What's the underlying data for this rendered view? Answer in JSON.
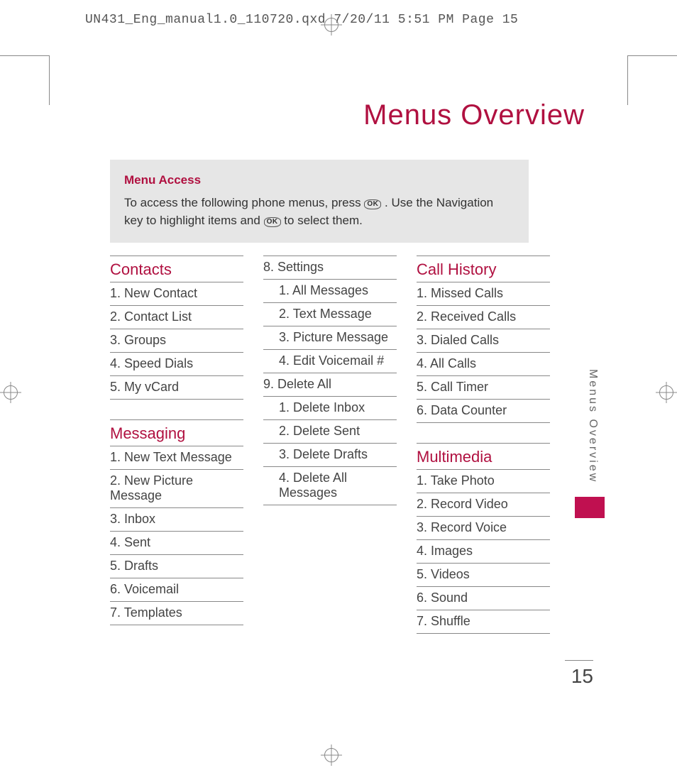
{
  "header_line": "UN431_Eng_manual1.0_110720.qxd  7/20/11  5:51 PM  Page 15",
  "page_title": "Menus Overview",
  "info_box": {
    "label": "Menu Access",
    "text_part1": "To access the following phone menus, press ",
    "text_part2": ". Use the Navigation key to highlight items and ",
    "text_part3": " to select them.",
    "ok_label": "OK"
  },
  "side_tab": "Menus Overview",
  "page_number": "15",
  "col1": {
    "s1_title": "Contacts",
    "s1_items": [
      "1. New Contact",
      "2. Contact List",
      "3. Groups",
      "4. Speed Dials",
      "5. My vCard"
    ],
    "s2_title": "Messaging",
    "s2_items": [
      "1. New Text Message",
      "2. New Picture Message",
      "3. Inbox",
      "4. Sent",
      "5. Drafts",
      "6. Voicemail",
      "7.  Templates"
    ]
  },
  "col2": {
    "items": [
      {
        "t": "8. Settings",
        "sub": false
      },
      {
        "t": "1. All Messages",
        "sub": true
      },
      {
        "t": "2. Text Message",
        "sub": true
      },
      {
        "t": "3. Picture Message",
        "sub": true
      },
      {
        "t": "4. Edit Voicemail #",
        "sub": true
      },
      {
        "t": "9. Delete All",
        "sub": false
      },
      {
        "t": "1. Delete Inbox",
        "sub": true
      },
      {
        "t": "2. Delete Sent",
        "sub": true
      },
      {
        "t": "3. Delete Drafts",
        "sub": true
      },
      {
        "t": "4. Delete All Messages",
        "sub": true,
        "last": true
      }
    ]
  },
  "col3": {
    "s1_title": "Call History",
    "s1_items": [
      "1. Missed Calls",
      "2. Received Calls",
      "3. Dialed Calls",
      "4. All Calls",
      "5. Call Timer",
      "6. Data Counter"
    ],
    "s2_title": "Multimedia",
    "s2_items": [
      "1. Take Photo",
      "2. Record Video",
      "3. Record Voice",
      "4. Images",
      "5. Videos",
      "6. Sound",
      "7.  Shuffle"
    ]
  }
}
